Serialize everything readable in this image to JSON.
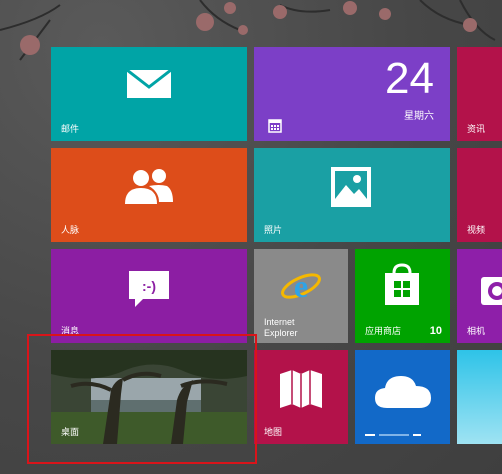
{
  "tiles": {
    "mail": {
      "label": "邮件",
      "color": "#00a4a6"
    },
    "calendar": {
      "day_number": "24",
      "weekday": "星期六",
      "color": "#7c3fc7"
    },
    "news": {
      "label": "资讯",
      "color": "#b3124a"
    },
    "people": {
      "label": "人脉",
      "color": "#dd4d1a"
    },
    "photos": {
      "label": "照片",
      "color": "#1aa0a4"
    },
    "video": {
      "label": "视频",
      "color": "#b3124a"
    },
    "messaging": {
      "label": "消息",
      "color": "#8c1ea3"
    },
    "ie": {
      "label_line1": "Internet",
      "label_line2": "Explorer",
      "color": "#8a8a8a"
    },
    "store": {
      "label": "应用商店",
      "badge": "10",
      "color": "#00a300"
    },
    "camera": {
      "label": "相机",
      "color": "#8e1fa9"
    },
    "desktop": {
      "label": "桌面"
    },
    "maps": {
      "label": "地图",
      "color": "#b3124a"
    },
    "skydrive": {
      "label": "",
      "color": "#1269c8"
    }
  },
  "highlight_color": "#d9141a",
  "icons": [
    "mail-icon",
    "calendar-icon",
    "people-icon",
    "photos-icon",
    "messaging-icon",
    "ie-icon",
    "store-icon",
    "camera-icon",
    "maps-icon",
    "cloud-icon"
  ]
}
